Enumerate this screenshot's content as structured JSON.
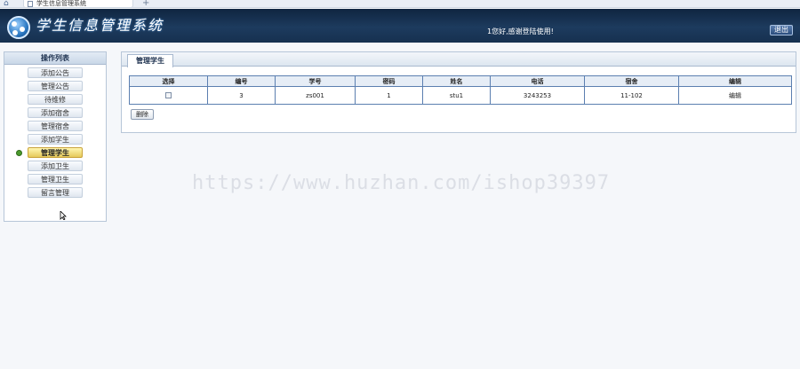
{
  "browser": {
    "tab_title": "学生信息管理系统",
    "new_tab": "+"
  },
  "header": {
    "title": "学生信息管理系统",
    "welcome": "1您好,感谢登陆使用!",
    "logout": "退出"
  },
  "sidebar": {
    "heading": "操作列表",
    "items": [
      {
        "label": "添加公告"
      },
      {
        "label": "管理公告"
      },
      {
        "label": "待维修"
      },
      {
        "label": "添加宿舍"
      },
      {
        "label": "管理宿舍"
      },
      {
        "label": "添加学生"
      },
      {
        "label": "管理学生",
        "active": true
      },
      {
        "label": "添加卫生"
      },
      {
        "label": "管理卫生"
      },
      {
        "label": "留言管理"
      }
    ]
  },
  "main": {
    "tab": "管理学生",
    "columns": [
      "选择",
      "编号",
      "学号",
      "密码",
      "姓名",
      "电话",
      "宿舍",
      "编辑"
    ],
    "rows": [
      {
        "id": "3",
        "student_no": "zs001",
        "password": "1",
        "name": "stu1",
        "phone": "3243253",
        "dorm": "11-102",
        "edit": "编辑"
      }
    ],
    "delete_label": "删除"
  },
  "watermark": "https://www.huzhan.com/ishop39397"
}
